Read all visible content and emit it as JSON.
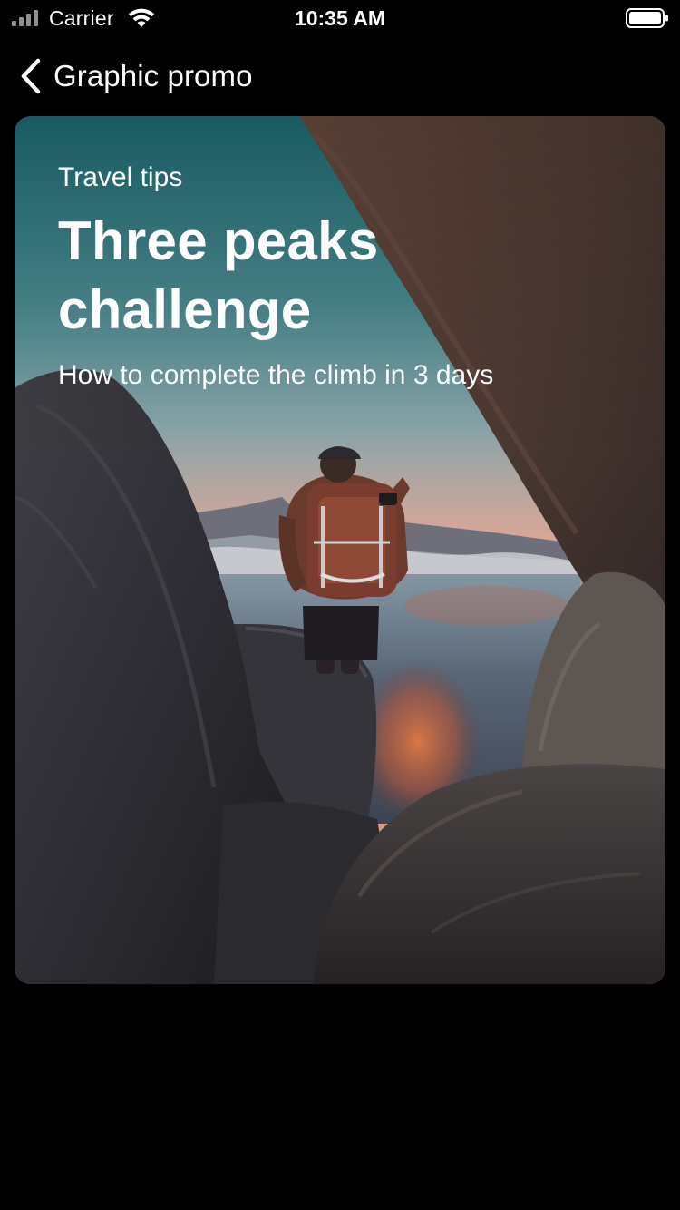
{
  "status_bar": {
    "carrier": "Carrier",
    "time": "10:35 AM",
    "signal_icon": "cellular-signal-icon",
    "wifi_icon": "wifi-icon",
    "battery_icon": "battery-full-icon"
  },
  "nav": {
    "back_icon": "chevron-left-icon",
    "title": "Graphic promo"
  },
  "promo": {
    "eyebrow": "Travel tips",
    "title": "Three peaks challenge",
    "subtitle": "How to complete the climb in 3 days",
    "image": "photo of a hiker with a backpack on a rock ledge overlooking mountains at sunset, framed by boulders"
  },
  "colors": {
    "background": "#000000",
    "text": "#ffffff",
    "sky_top": "#2f6f7a",
    "sky_horizon": "#e3a790",
    "rock": "#3a3a3e"
  }
}
